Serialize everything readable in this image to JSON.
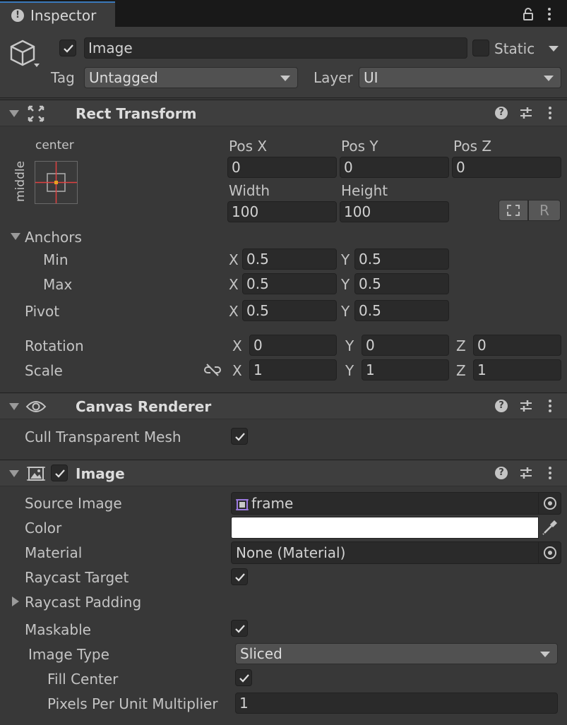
{
  "tab": {
    "title": "Inspector"
  },
  "object": {
    "name": "Image",
    "static_label": "Static",
    "tag_label": "Tag",
    "tag_value": "Untagged",
    "layer_label": "Layer",
    "layer_value": "UI"
  },
  "rect_transform": {
    "title": "Rect Transform",
    "anchor_h": "center",
    "anchor_v": "middle",
    "pos_x_label": "Pos X",
    "pos_y_label": "Pos Y",
    "pos_z_label": "Pos Z",
    "pos_x": "0",
    "pos_y": "0",
    "pos_z": "0",
    "width_label": "Width",
    "height_label": "Height",
    "width": "100",
    "height": "100",
    "raw_button": "R",
    "anchors_label": "Anchors",
    "min_label": "Min",
    "max_label": "Max",
    "min_x": "0.5",
    "min_y": "0.5",
    "max_x": "0.5",
    "max_y": "0.5",
    "pivot_label": "Pivot",
    "pivot_x": "0.5",
    "pivot_y": "0.5",
    "rotation_label": "Rotation",
    "rot_x": "0",
    "rot_y": "0",
    "rot_z": "0",
    "scale_label": "Scale",
    "scale_x": "1",
    "scale_y": "1",
    "scale_z": "1",
    "axis_x": "X",
    "axis_y": "Y",
    "axis_z": "Z"
  },
  "canvas_renderer": {
    "title": "Canvas Renderer",
    "cull_label": "Cull Transparent Mesh",
    "cull_checked": true
  },
  "image": {
    "title": "Image",
    "source_image_label": "Source Image",
    "source_image_value": "frame",
    "color_label": "Color",
    "color_value": "#ffffff",
    "material_label": "Material",
    "material_value": "None (Material)",
    "raycast_target_label": "Raycast Target",
    "raycast_padding_label": "Raycast Padding",
    "maskable_label": "Maskable",
    "image_type_label": "Image Type",
    "image_type_value": "Sliced",
    "fill_center_label": "Fill Center",
    "ppu_label": "Pixels Per Unit Multiplier",
    "ppu_value": "1"
  },
  "colors": {
    "background": "#383838",
    "header": "#3e3e3e",
    "field": "#2a2a2a",
    "tab_accent": "#3a79bb",
    "anchor_red": "#e04040",
    "anchor_orange": "#e8a020"
  }
}
